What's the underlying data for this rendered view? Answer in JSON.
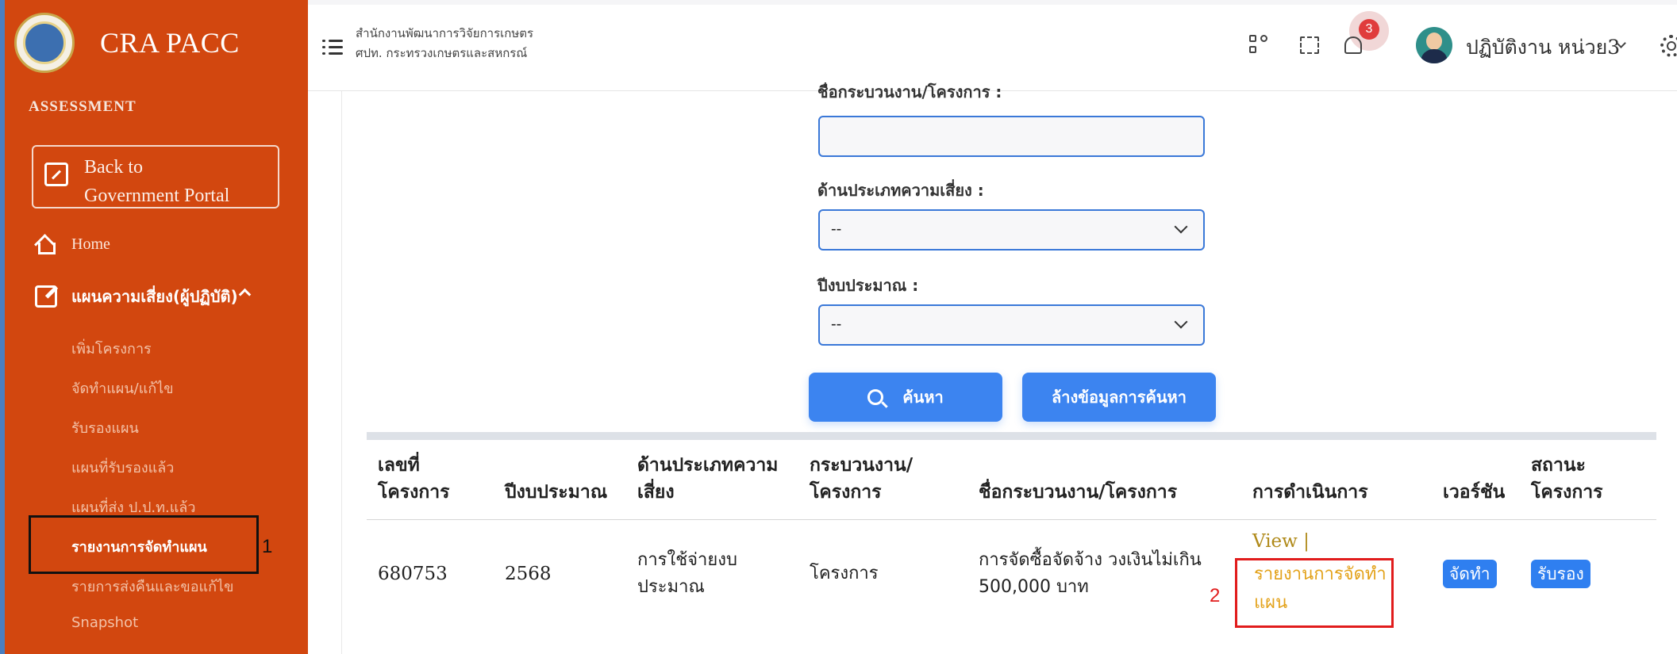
{
  "sidebar": {
    "brand": "CRA PACC",
    "section_label": "ASSESSMENT",
    "back_button": {
      "line1": "Back to",
      "line2": "Government Portal"
    },
    "home_label": "Home",
    "group_label": "แผนความเสี่ยง(ผู้ปฏิบัติ)",
    "items": [
      {
        "label": "เพิ่มโครงการ"
      },
      {
        "label": "จัดทำแผน/แก้ไข"
      },
      {
        "label": "รับรองแผน"
      },
      {
        "label": "แผนที่รับรองแล้ว"
      },
      {
        "label": "แผนที่ส่ง ป.ป.ท.แล้ว"
      },
      {
        "label": "รายงานการจัดทำแผน"
      },
      {
        "label": "รายการส่งคืนและขอแก้ไข"
      },
      {
        "label": "Snapshot"
      }
    ],
    "annotation_marker": "1"
  },
  "header": {
    "org_line1": "สำนักงานพัฒนาการวิจัยการเกษตร",
    "org_line2": "ศปท. กระทรวงเกษตรและสหกรณ์",
    "notification_count": "3",
    "user_name": "ปฏิบัติงาน หน่วย3"
  },
  "form": {
    "project_name_label": "ชื่อกระบวนงาน/โครงการ :",
    "project_name_value": "",
    "risk_type_label": "ด้านประเภทความเสี่ยง :",
    "risk_type_value": "--",
    "budget_year_label": "ปีงบประมาณ :",
    "budget_year_value": "--",
    "search_button": "ค้นหา",
    "clear_button": "ล้างข้อมูลการค้นหา"
  },
  "table": {
    "headers": {
      "project_no_1": "เลขที่",
      "project_no_2": "โครงการ",
      "budget_year": "ปีงบประมาณ",
      "risk_type_1": "ด้านประเภทความ",
      "risk_type_2": "เสี่ยง",
      "process_1": "กระบวนงาน/",
      "process_2": "โครงการ",
      "name": "ชื่อกระบวนงาน/โครงการ",
      "action": "การดำเนินการ",
      "version": "เวอร์ชัน",
      "status_1": "สถานะ",
      "status_2": "โครงการ"
    },
    "rows": [
      {
        "project_no": "680753",
        "budget_year": "2568",
        "risk_type_1": "การใช้จ่ายงบ",
        "risk_type_2": "ประมาณ",
        "process": "โครงการ",
        "name_1": "การจัดซื้อจัดจ้าง วงเงินไม่เกิน",
        "name_2": "500,000 บาท",
        "action_view": "View |",
        "action_report_1": "รายงานการจัดทำ",
        "action_report_2": "แผน",
        "version": "จัดทำ",
        "status": "รับรอง"
      }
    ],
    "annotation_marker": "2"
  },
  "colors": {
    "sidebar_bg": "#d2470f",
    "primary_button": "#3c84f0",
    "link_gold": "#e3a21a",
    "annotation_red": "#e11c1c",
    "badge_red": "#e03c3c"
  }
}
